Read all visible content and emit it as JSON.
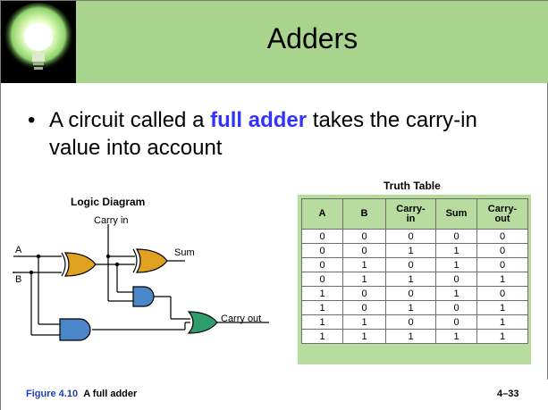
{
  "slide": {
    "title": "Adders",
    "bullet_prefix": "A circuit called a ",
    "bullet_highlight": "full adder",
    "bullet_suffix": " takes the carry-in value into account",
    "highlight_color": "#3333ff",
    "banner_color": "#a8d48e"
  },
  "diagram": {
    "title": "Logic Diagram",
    "label_carry_in": "Carry in",
    "label_a": "A",
    "label_b": "B",
    "label_sum": "Sum",
    "label_carry_out": "Carry out",
    "xor_color": "#e0a020",
    "and_color": "#4a86c8",
    "or_color": "#2e9e6e"
  },
  "truth_table": {
    "title": "Truth Table",
    "headers": [
      "A",
      "B",
      "Carry-in",
      "Sum",
      "Carry-out"
    ],
    "header_lines": [
      [
        "A"
      ],
      [
        "B"
      ],
      [
        "Carry-",
        "in"
      ],
      [
        "Sum"
      ],
      [
        "Carry-",
        "out"
      ]
    ],
    "rows": [
      [
        "0",
        "0",
        "0",
        "0",
        "0"
      ],
      [
        "0",
        "0",
        "1",
        "1",
        "0"
      ],
      [
        "0",
        "1",
        "0",
        "1",
        "0"
      ],
      [
        "0",
        "1",
        "1",
        "0",
        "1"
      ],
      [
        "1",
        "0",
        "0",
        "1",
        "0"
      ],
      [
        "1",
        "0",
        "1",
        "0",
        "1"
      ],
      [
        "1",
        "1",
        "0",
        "0",
        "1"
      ],
      [
        "1",
        "1",
        "1",
        "1",
        "1"
      ]
    ]
  },
  "footer": {
    "figure_label": "Figure 4.10",
    "figure_caption": "A full adder",
    "page_number": "4–33"
  }
}
